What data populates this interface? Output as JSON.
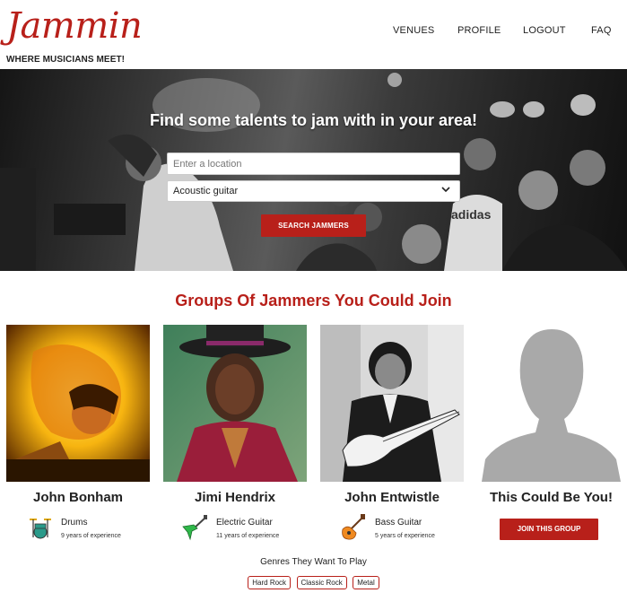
{
  "brand": {
    "logo": "Jammin",
    "tagline": "WHERE MUSICIANS MEET!"
  },
  "nav": {
    "items": [
      "VENUES",
      "PROFILE",
      "LOGOUT",
      "FAQ"
    ]
  },
  "hero": {
    "title": "Find some talents to jam with in your area!",
    "location_placeholder": "Enter a location",
    "instrument_selected": "Acoustic guitar",
    "search_label": "SEARCH JAMMERS",
    "shirt_text": "adidas"
  },
  "groups": {
    "title": "Groups Of Jammers You Could Join",
    "members": [
      {
        "name": "John Bonham",
        "instrument": "Drums",
        "experience": "9 years of experience",
        "icon": "drums-icon"
      },
      {
        "name": "Jimi Hendrix",
        "instrument": "Electric Guitar",
        "experience": "11 years of experience",
        "icon": "electric-guitar-icon"
      },
      {
        "name": "John Entwistle",
        "instrument": "Bass Guitar",
        "experience": "5 years of experience",
        "icon": "bass-guitar-icon"
      }
    ],
    "placeholder_name": "This Could Be You!",
    "join_label": "JOIN THIS GROUP",
    "genres_label": "Genres They Want To Play",
    "genres": [
      "Hard Rock",
      "Classic Rock",
      "Metal"
    ]
  },
  "colors": {
    "accent": "#b8201a"
  }
}
